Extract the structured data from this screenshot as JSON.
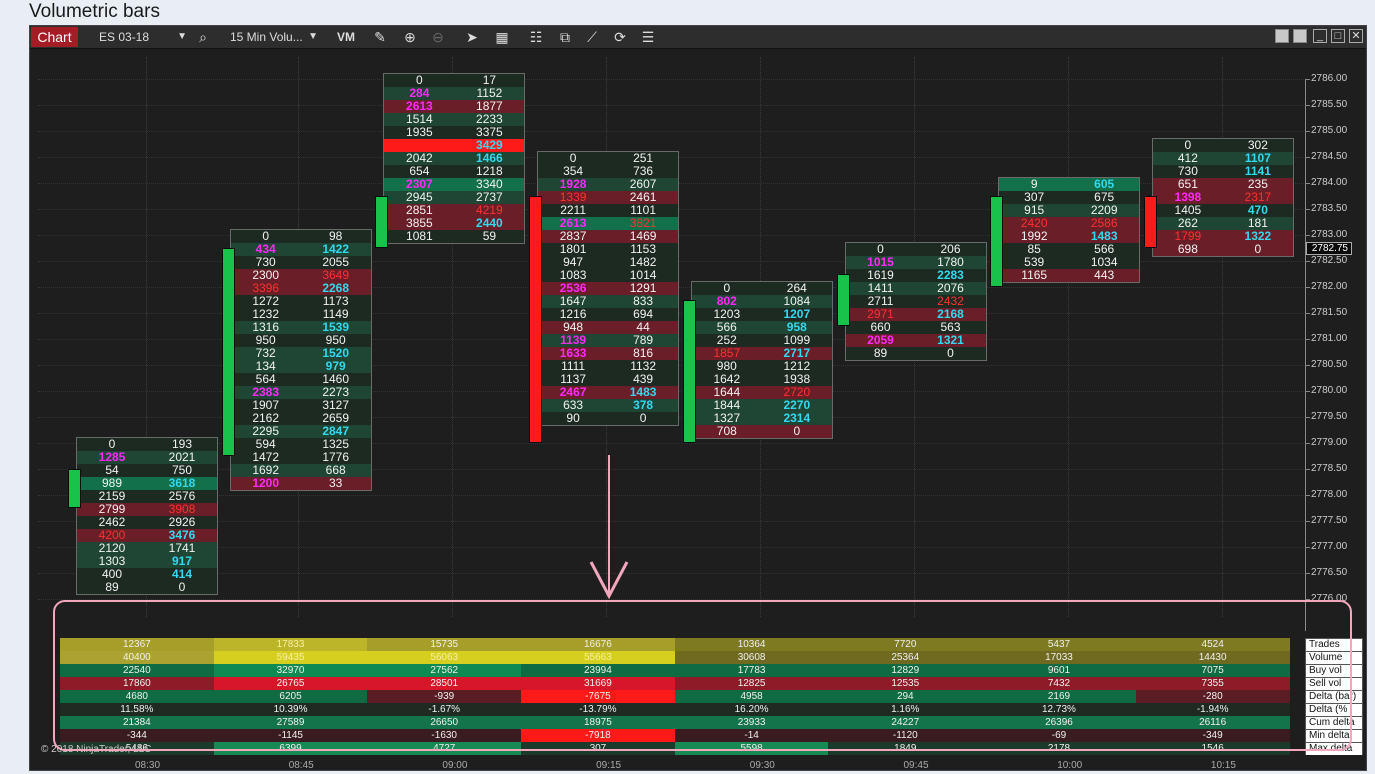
{
  "page": {
    "title": "Volumetric bars"
  },
  "toolbar": {
    "chart_label": "Chart",
    "instrument": "ES 03-18",
    "interval": "15 Min Volu...",
    "vm_label": "VM"
  },
  "price_axis": {
    "labels": [
      "2786.00",
      "2785.50",
      "2785.00",
      "2784.50",
      "2784.00",
      "2783.50",
      "2783.00",
      "2782.50",
      "2782.00",
      "2781.50",
      "2781.00",
      "2780.50",
      "2780.00",
      "2779.50",
      "2779.00",
      "2778.50",
      "2778.00",
      "2777.50",
      "2777.00",
      "2776.50",
      "2776.00"
    ],
    "last_price": "2782.75"
  },
  "time_axis": {
    "labels": [
      "08:30",
      "08:45",
      "09:00",
      "09:15",
      "09:30",
      "09:45",
      "10:00",
      "10:15"
    ]
  },
  "colors": {
    "up": "#19c34a",
    "down": "#ff1a1a",
    "bid_max": "#ff28ff",
    "ask_max": "#32d9f0",
    "imbalance_red": "#ff3030",
    "highlight": "#e0d61e",
    "annotation": "#f2a7bd"
  },
  "bars": [
    {
      "direction": "up",
      "top_price": 2779.0,
      "bottom_price": 2776.25,
      "candle_open": 2778.5,
      "candle_close": 2777.75,
      "rows": [
        [
          "0",
          "193"
        ],
        [
          "1285",
          "2021"
        ],
        [
          "54",
          "750"
        ],
        [
          "989",
          "3618"
        ],
        [
          "2159",
          "2576"
        ],
        [
          "2799",
          "3908"
        ],
        [
          "2462",
          "2926"
        ],
        [
          "4200",
          "3476"
        ],
        [
          "2120",
          "1741"
        ],
        [
          "1303",
          "917"
        ],
        [
          "400",
          "414"
        ],
        [
          "89",
          "0"
        ]
      ],
      "styles": [
        [
          "",
          ""
        ],
        [
          "b",
          ""
        ],
        [
          "",
          ""
        ],
        [
          "",
          "a"
        ],
        [
          "",
          ""
        ],
        [
          "",
          "r"
        ],
        [
          "",
          ""
        ],
        [
          "r",
          "a"
        ],
        [
          "",
          ""
        ],
        [
          "",
          "a"
        ],
        [
          "",
          "a"
        ],
        [
          "",
          ""
        ]
      ],
      "shade": [
        0,
        1,
        0,
        2,
        0,
        3,
        0,
        3,
        1,
        1,
        0,
        0
      ]
    },
    {
      "direction": "up",
      "top_price": 2783.0,
      "bottom_price": 2778.5,
      "candle_open": 2782.75,
      "candle_close": 2778.75,
      "rows": [
        [
          "0",
          "98"
        ],
        [
          "434",
          "1422"
        ],
        [
          "730",
          "2055"
        ],
        [
          "2300",
          "3649"
        ],
        [
          "3396",
          "2268"
        ],
        [
          "1272",
          "1173"
        ],
        [
          "1232",
          "1149"
        ],
        [
          "1316",
          "1539"
        ],
        [
          "950",
          "950"
        ],
        [
          "732",
          "1520"
        ],
        [
          "134",
          "979"
        ],
        [
          "564",
          "1460"
        ],
        [
          "2383",
          "2273"
        ],
        [
          "1907",
          "3127"
        ],
        [
          "2162",
          "2659"
        ],
        [
          "2295",
          "2847"
        ],
        [
          "594",
          "1325"
        ],
        [
          "1472",
          "1776"
        ],
        [
          "1692",
          "668"
        ],
        [
          "1200",
          "33"
        ]
      ],
      "styles": [
        [
          "",
          ""
        ],
        [
          "b",
          "a"
        ],
        [
          "",
          ""
        ],
        [
          "",
          "r"
        ],
        [
          "r",
          "a"
        ],
        [
          "",
          ""
        ],
        [
          "",
          ""
        ],
        [
          "",
          "a"
        ],
        [
          "",
          ""
        ],
        [
          "",
          "a"
        ],
        [
          "",
          "a"
        ],
        [
          "",
          ""
        ],
        [
          "b",
          ""
        ],
        [
          "",
          ""
        ],
        [
          "",
          ""
        ],
        [
          "",
          "a"
        ],
        [
          "",
          ""
        ],
        [
          "",
          ""
        ],
        [
          "",
          ""
        ],
        [
          "b",
          ""
        ]
      ],
      "shade": [
        0,
        1,
        0,
        3,
        3,
        0,
        0,
        1,
        0,
        1,
        1,
        0,
        1,
        0,
        0,
        1,
        0,
        0,
        1,
        3
      ]
    },
    {
      "direction": "up",
      "top_price": 2786.0,
      "bottom_price": 2783.25,
      "candle_open": 2783.75,
      "candle_close": 2782.75,
      "rows": [
        [
          "0",
          "17"
        ],
        [
          "284",
          "1152"
        ],
        [
          "2613",
          "1877"
        ],
        [
          "1514",
          "2233"
        ],
        [
          "1935",
          "3375"
        ],
        [
          "",
          ""
        ],
        [
          "2042",
          "1466"
        ],
        [
          "654",
          "1218"
        ],
        [
          "2307",
          "3340"
        ],
        [
          "2945",
          "2737"
        ],
        [
          "2851",
          "4219"
        ],
        [
          "3855",
          "2440"
        ],
        [
          "1081",
          "59"
        ]
      ],
      "styles": [
        [
          "",
          ""
        ],
        [
          "b",
          ""
        ],
        [
          "b",
          ""
        ],
        [
          "",
          ""
        ],
        [
          "",
          ""
        ],
        [
          "",
          "a"
        ],
        [
          "",
          "a"
        ],
        [
          "",
          ""
        ],
        [
          "b",
          ""
        ],
        [
          "",
          ""
        ],
        [
          "",
          "r"
        ],
        [
          "",
          "a"
        ],
        [
          "",
          ""
        ]
      ],
      "shade": [
        0,
        1,
        3,
        1,
        0,
        4,
        1,
        0,
        2,
        1,
        3,
        3,
        0
      ],
      "special": {
        "row": 5,
        "text": "3429"
      }
    },
    {
      "direction": "down",
      "top_price": 2784.5,
      "bottom_price": 2779.25,
      "candle_open": 2783.75,
      "candle_close": 2779.0,
      "rows": [
        [
          "0",
          "251"
        ],
        [
          "354",
          "736"
        ],
        [
          "1928",
          "2607"
        ],
        [
          "1339",
          "2461"
        ],
        [
          "2211",
          "1101"
        ],
        [
          "2613",
          "3821"
        ],
        [
          "2837",
          "1469"
        ],
        [
          "1801",
          "1153"
        ],
        [
          "947",
          "1482"
        ],
        [
          "1083",
          "1014"
        ],
        [
          "2536",
          "1291"
        ],
        [
          "1647",
          "833"
        ],
        [
          "1216",
          "694"
        ],
        [
          "948",
          "44"
        ],
        [
          "1139",
          "789"
        ],
        [
          "1633",
          "816"
        ],
        [
          "1111",
          "1132"
        ],
        [
          "1137",
          "439"
        ],
        [
          "2467",
          "1483"
        ],
        [
          "633",
          "378"
        ],
        [
          "90",
          "0"
        ]
      ],
      "styles": [
        [
          "",
          ""
        ],
        [
          "",
          ""
        ],
        [
          "b",
          ""
        ],
        [
          "r",
          ""
        ],
        [
          "",
          ""
        ],
        [
          "b",
          "r"
        ],
        [
          "",
          ""
        ],
        [
          "",
          ""
        ],
        [
          "",
          ""
        ],
        [
          "",
          ""
        ],
        [
          "b",
          ""
        ],
        [
          "",
          ""
        ],
        [
          "",
          ""
        ],
        [
          "",
          ""
        ],
        [
          "b",
          ""
        ],
        [
          "b",
          ""
        ],
        [
          "",
          ""
        ],
        [
          "",
          ""
        ],
        [
          "b",
          "a"
        ],
        [
          "",
          "a"
        ],
        [
          "",
          ""
        ]
      ],
      "shade": [
        0,
        0,
        1,
        3,
        0,
        2,
        3,
        0,
        0,
        0,
        3,
        1,
        0,
        3,
        1,
        3,
        0,
        0,
        3,
        1,
        0
      ]
    },
    {
      "direction": "up",
      "top_price": 2782.0,
      "bottom_price": 2778.75,
      "candle_open": 2781.75,
      "candle_close": 2779.0,
      "rows": [
        [
          "0",
          "264"
        ],
        [
          "802",
          "1084"
        ],
        [
          "1203",
          "1207"
        ],
        [
          "566",
          "958"
        ],
        [
          "252",
          "1099"
        ],
        [
          "1857",
          "2717"
        ],
        [
          "980",
          "1212"
        ],
        [
          "1642",
          "1938"
        ],
        [
          "1644",
          "2720"
        ],
        [
          "1844",
          "2270"
        ],
        [
          "1327",
          "2314"
        ],
        [
          "708",
          "0"
        ]
      ],
      "styles": [
        [
          "",
          ""
        ],
        [
          "b",
          ""
        ],
        [
          "",
          "a"
        ],
        [
          "",
          "a"
        ],
        [
          "",
          ""
        ],
        [
          "r",
          "a"
        ],
        [
          "",
          ""
        ],
        [
          "",
          ""
        ],
        [
          "",
          "r"
        ],
        [
          "",
          "a"
        ],
        [
          "",
          "a"
        ],
        [
          "",
          ""
        ]
      ],
      "shade": [
        0,
        1,
        0,
        1,
        0,
        3,
        0,
        0,
        3,
        1,
        1,
        3
      ]
    },
    {
      "direction": "up",
      "top_price": 2782.75,
      "bottom_price": 2780.5,
      "candle_open": 2782.25,
      "candle_close": 2781.25,
      "rows": [
        [
          "0",
          "206"
        ],
        [
          "1015",
          "1780"
        ],
        [
          "1619",
          "2283"
        ],
        [
          "1411",
          "2076"
        ],
        [
          "2711",
          "2432"
        ],
        [
          "2971",
          "2168"
        ],
        [
          "660",
          "563"
        ],
        [
          "2059",
          "1321"
        ],
        [
          "89",
          "0"
        ]
      ],
      "styles": [
        [
          "",
          ""
        ],
        [
          "b",
          ""
        ],
        [
          "",
          "a"
        ],
        [
          "",
          ""
        ],
        [
          "",
          "r"
        ],
        [
          "r",
          "a"
        ],
        [
          "",
          ""
        ],
        [
          "b",
          "a"
        ],
        [
          "",
          ""
        ]
      ],
      "shade": [
        0,
        1,
        0,
        1,
        0,
        3,
        0,
        3,
        0
      ]
    },
    {
      "direction": "up",
      "top_price": 2784.0,
      "bottom_price": 2782.0,
      "candle_open": 2783.75,
      "candle_close": 2782.0,
      "rows": [
        [
          "9",
          "605"
        ],
        [
          "307",
          "675"
        ],
        [
          "915",
          "2209"
        ],
        [
          "2420",
          "2586"
        ],
        [
          "1992",
          "1483"
        ],
        [
          "85",
          "566"
        ],
        [
          "539",
          "1034"
        ],
        [
          "1165",
          "443"
        ]
      ],
      "styles": [
        [
          "",
          "a"
        ],
        [
          "",
          ""
        ],
        [
          "",
          ""
        ],
        [
          "r",
          "r"
        ],
        [
          "",
          "a"
        ],
        [
          "",
          ""
        ],
        [
          "",
          ""
        ],
        [
          "",
          ""
        ]
      ],
      "shade": [
        2,
        0,
        1,
        3,
        3,
        0,
        0,
        3
      ]
    },
    {
      "direction": "down",
      "top_price": 2784.75,
      "bottom_price": 2782.5,
      "candle_open": 2783.75,
      "candle_close": 2782.75,
      "rows": [
        [
          "0",
          "302"
        ],
        [
          "412",
          "1107"
        ],
        [
          "730",
          "1141"
        ],
        [
          "651",
          "235"
        ],
        [
          "1398",
          "2317"
        ],
        [
          "1405",
          "470"
        ],
        [
          "262",
          "181"
        ],
        [
          "1799",
          "1322"
        ],
        [
          "698",
          "0"
        ]
      ],
      "styles": [
        [
          "",
          ""
        ],
        [
          "",
          "a"
        ],
        [
          "",
          "a"
        ],
        [
          "",
          ""
        ],
        [
          "b",
          "r"
        ],
        [
          "",
          "a"
        ],
        [
          "",
          ""
        ],
        [
          "r",
          "a"
        ],
        [
          "",
          ""
        ]
      ],
      "shade": [
        0,
        1,
        0,
        3,
        3,
        0,
        1,
        3,
        3
      ]
    }
  ],
  "stats_table": {
    "row_labels": [
      "Trades",
      "Volume",
      "Buy vol",
      "Sell vol",
      "Delta (bar)",
      "Delta (%",
      "Cum delta",
      "Min delta",
      "Max delta"
    ],
    "columns": [
      [
        "12367",
        "40400",
        "22540",
        "17860",
        "4680",
        "11.58%",
        "21384",
        "-344",
        "5486"
      ],
      [
        "17833",
        "59435",
        "32970",
        "26765",
        "6205",
        "10.39%",
        "27589",
        "-1145",
        "6399"
      ],
      [
        "15735",
        "56063",
        "27562",
        "28501",
        "-939",
        "-1.67%",
        "26650",
        "-1630",
        "4727"
      ],
      [
        "16676",
        "55663",
        "23994",
        "31669",
        "-7675",
        "-13.79%",
        "18975",
        "-7918",
        "307"
      ],
      [
        "10364",
        "30608",
        "17783",
        "12825",
        "4958",
        "16.20%",
        "23933",
        "-14",
        "5598"
      ],
      [
        "7720",
        "25364",
        "12829",
        "12535",
        "294",
        "1.16%",
        "24227",
        "-1120",
        "1849"
      ],
      [
        "5437",
        "17033",
        "9601",
        "7432",
        "2169",
        "12.73%",
        "26396",
        "-69",
        "2178"
      ],
      [
        "4524",
        "14430",
        "7075",
        "7355",
        "-280",
        "-1.94%",
        "26116",
        "-349",
        "1546"
      ]
    ]
  },
  "copyright": "© 2018 NinjaTrader, LLC"
}
